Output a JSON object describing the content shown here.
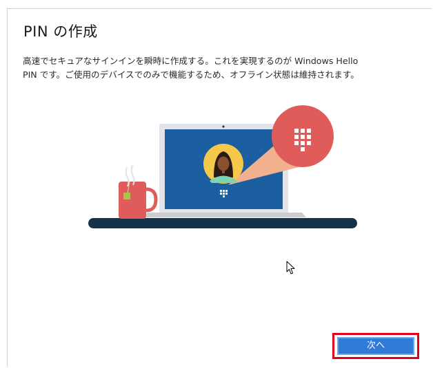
{
  "dialog": {
    "title": "PIN の作成",
    "description_line1": "高速でセキュアなサインインを瞬時に作成する。これを実現するのが Windows Hello",
    "description_line2": "PIN です。ご使用のデバイスでのみで機能するため、オフライン状態は維持されます。",
    "next_button_label": "次へ"
  },
  "colors": {
    "accent": "#2f7bd7",
    "highlight": "#e0001b",
    "screen": "#1c5fa0",
    "bubble": "#e05c5a"
  },
  "icons": [
    "keypad-icon",
    "cursor-icon"
  ]
}
